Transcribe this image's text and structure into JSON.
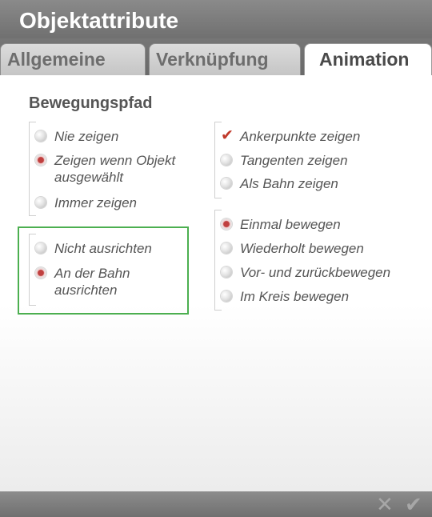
{
  "window": {
    "title": "Objektattribute"
  },
  "tabs": [
    {
      "label": "Allgemeine",
      "active": false
    },
    {
      "label": "Verknüpfung",
      "active": false
    },
    {
      "label": "Animation",
      "active": true
    }
  ],
  "section": {
    "title": "Bewegungspfad"
  },
  "left_group_1": [
    {
      "label": "Nie zeigen",
      "selected": false
    },
    {
      "label": "Zeigen wenn Objekt",
      "label2": "ausgewählt",
      "selected": true
    },
    {
      "label": "Immer zeigen",
      "selected": false
    }
  ],
  "left_group_2": [
    {
      "label": "Nicht ausrichten",
      "selected": false
    },
    {
      "label": "An der Bahn",
      "label2": "ausrichten",
      "selected": true
    }
  ],
  "right_group_1": [
    {
      "label": "Ankerpunkte zeigen",
      "type": "checkbox",
      "checked": true
    },
    {
      "label": "Tangenten zeigen",
      "selected": false
    },
    {
      "label": "Als Bahn zeigen",
      "selected": false
    }
  ],
  "right_group_2": [
    {
      "label": "Einmal bewegen",
      "selected": true
    },
    {
      "label": "Wiederholt bewegen",
      "selected": false
    },
    {
      "label": "Vor- und zurückbewegen",
      "selected": false
    },
    {
      "label": "Im Kreis bewegen",
      "selected": false
    }
  ],
  "footer": {
    "cancel_icon": "close-icon",
    "ok_icon": "checkmark-icon",
    "cancel_glyph": "✕",
    "ok_glyph": "✔"
  },
  "colors": {
    "accent": "#c0403f",
    "highlight_frame": "#4caf50",
    "chrome": "#7a7a7a"
  }
}
